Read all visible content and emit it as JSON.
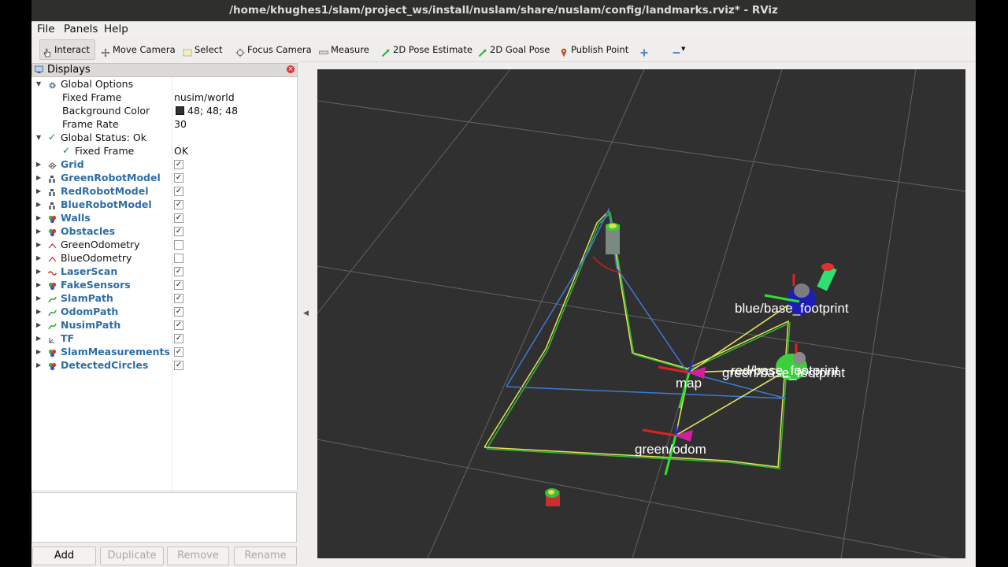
{
  "window": {
    "title": "/home/khughes1/slam/project_ws/install/nuslam/share/nuslam/config/landmarks.rviz* - RViz"
  },
  "menu": {
    "file": "File",
    "panels": "Panels",
    "help": "Help"
  },
  "toolbar": {
    "interact": "Interact",
    "move_camera": "Move Camera",
    "select": "Select",
    "focus_camera": "Focus Camera",
    "measure": "Measure",
    "pose_estimate": "2D Pose Estimate",
    "goal_pose": "2D Goal Pose",
    "publish_point": "Publish Point"
  },
  "displays": {
    "title": "Displays",
    "global_options": {
      "label": "Global Options",
      "fixed_frame_label": "Fixed Frame",
      "fixed_frame_value": "nusim/world",
      "bg_color_label": "Background Color",
      "bg_color_value": "48; 48; 48",
      "bg_color_hex": "#303030",
      "frame_rate_label": "Frame Rate",
      "frame_rate_value": "30"
    },
    "global_status": {
      "label": "Global Status: Ok",
      "fixed_frame_label": "Fixed Frame",
      "fixed_frame_value": "OK"
    },
    "items": [
      {
        "label": "Grid",
        "checked": true,
        "link": true,
        "icon": "grid-icon"
      },
      {
        "label": "GreenRobotModel",
        "checked": true,
        "link": true,
        "icon": "robot-model-icon"
      },
      {
        "label": "RedRobotModel",
        "checked": true,
        "link": true,
        "icon": "robot-model-icon"
      },
      {
        "label": "BlueRobotModel",
        "checked": true,
        "link": true,
        "icon": "robot-model-icon"
      },
      {
        "label": "Walls",
        "checked": true,
        "link": true,
        "icon": "marker-array-icon"
      },
      {
        "label": "Obstacles",
        "checked": true,
        "link": true,
        "icon": "marker-array-icon"
      },
      {
        "label": "GreenOdometry",
        "checked": false,
        "link": false,
        "icon": "odometry-icon"
      },
      {
        "label": "BlueOdometry",
        "checked": false,
        "link": false,
        "icon": "odometry-icon"
      },
      {
        "label": "LaserScan",
        "checked": true,
        "link": true,
        "icon": "laserscan-icon"
      },
      {
        "label": "FakeSensors",
        "checked": true,
        "link": true,
        "icon": "marker-array-icon"
      },
      {
        "label": "SlamPath",
        "checked": true,
        "link": true,
        "icon": "path-icon"
      },
      {
        "label": "OdomPath",
        "checked": true,
        "link": true,
        "icon": "path-icon"
      },
      {
        "label": "NusimPath",
        "checked": true,
        "link": true,
        "icon": "path-icon"
      },
      {
        "label": "TF",
        "checked": true,
        "link": true,
        "icon": "tf-icon"
      },
      {
        "label": "SlamMeasurements",
        "checked": true,
        "link": true,
        "icon": "marker-array-icon"
      },
      {
        "label": "DetectedCircles",
        "checked": true,
        "link": true,
        "icon": "marker-array-icon"
      }
    ]
  },
  "buttons": {
    "add": "Add",
    "duplicate": "Duplicate",
    "remove": "Remove",
    "rename": "Rename"
  },
  "viewport": {
    "frame_labels": {
      "blue": "blue/base_footprint",
      "map": "map",
      "red": "red/base_footprint",
      "green_footprint": "green/base_footprint",
      "green_odom": "green/odom"
    }
  }
}
